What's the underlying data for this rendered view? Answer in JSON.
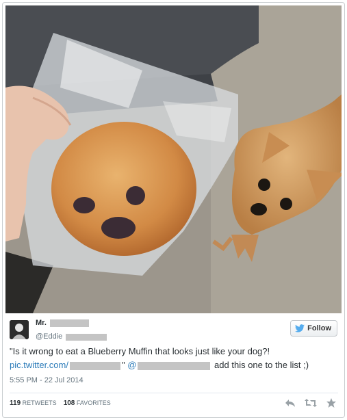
{
  "tweet": {
    "user_name": "Mr.",
    "user_handle": "@Eddie",
    "follow_label": "Follow",
    "text_line1": "\"Is it wrong to eat a Blueberry Muffin that looks just like your dog?!",
    "link_prefix": "pic.twitter.com/",
    "quote_close": "\"",
    "mention_prefix": "@",
    "text_line2_tail": "add this one to the list ;)",
    "timestamp": "5:55 PM - 22 Jul 2014",
    "retweets_count": "119",
    "retweets_label": "RETWEETS",
    "favorites_count": "108",
    "favorites_label": "FAVORITES"
  },
  "colors": {
    "link": "#2b7bb9",
    "twitter_bird": "#55acee",
    "muted": "#99a1a6"
  },
  "icons": [
    "twitter-bird-icon",
    "reply-icon",
    "retweet-icon",
    "favorite-icon"
  ]
}
